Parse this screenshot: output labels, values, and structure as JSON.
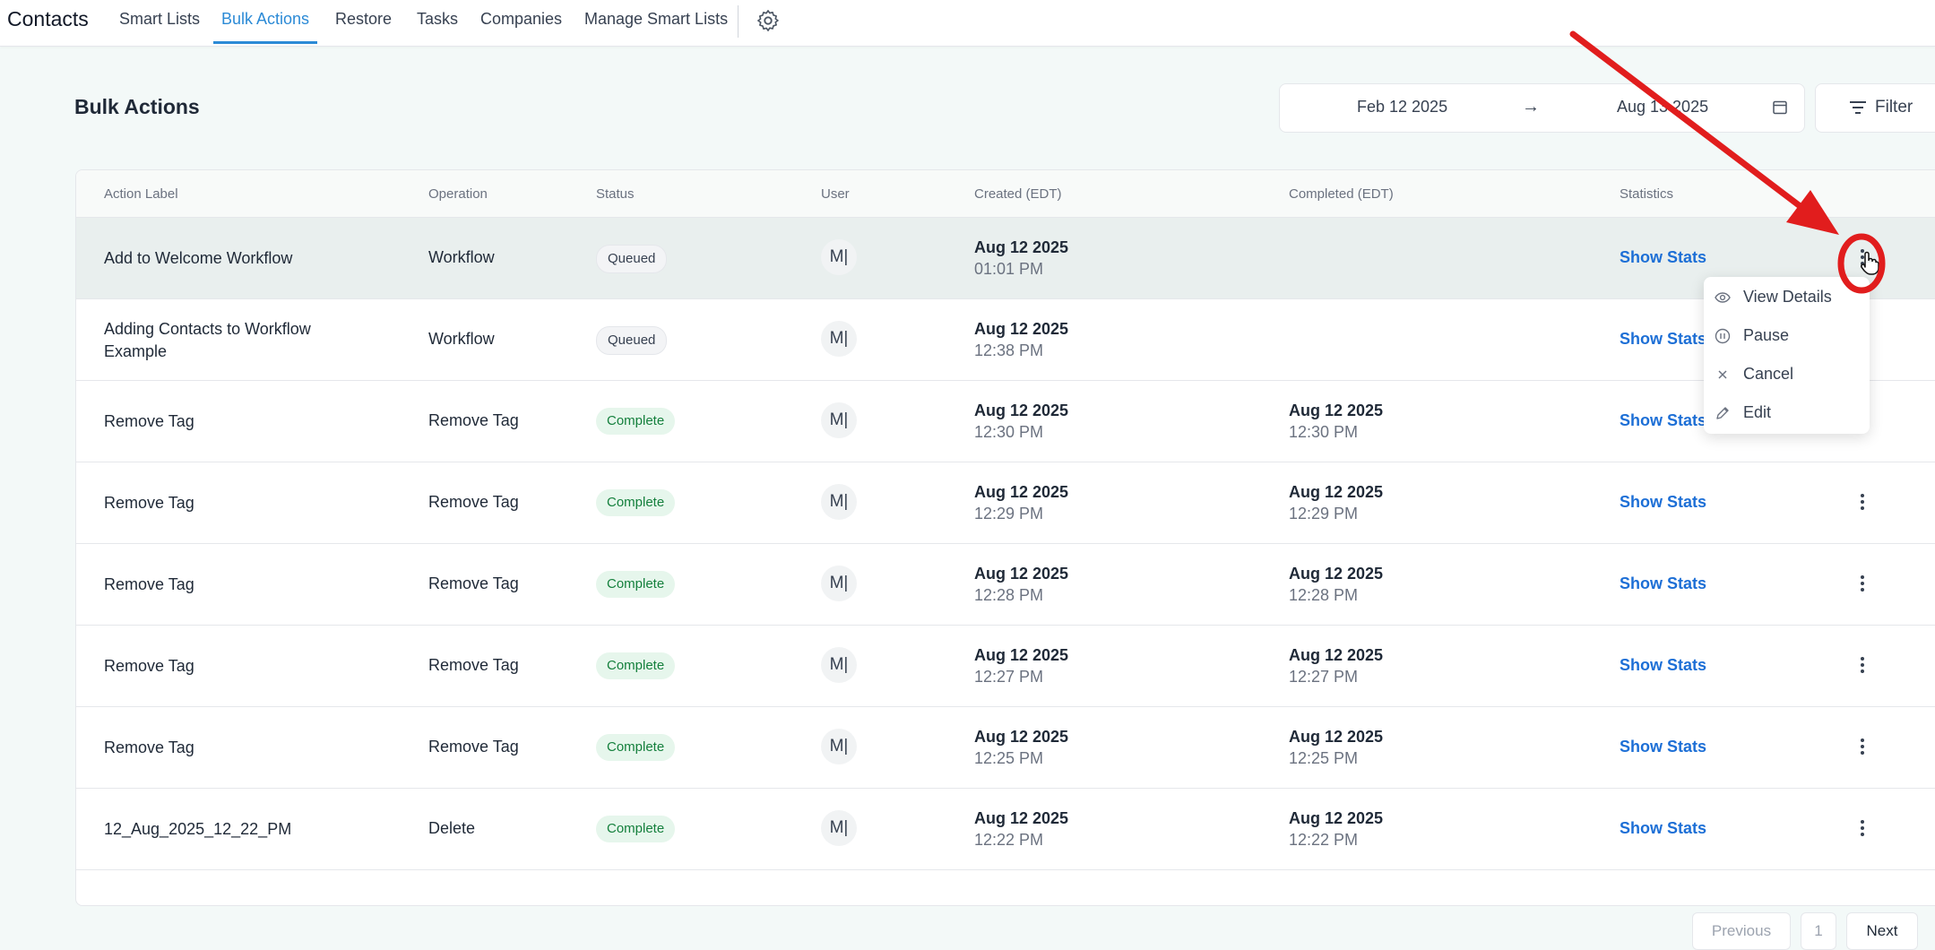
{
  "nav": {
    "brand": "Contacts",
    "tabs": [
      {
        "label": "Smart Lists"
      },
      {
        "label": "Bulk Actions"
      },
      {
        "label": "Restore"
      },
      {
        "label": "Tasks"
      },
      {
        "label": "Companies"
      },
      {
        "label": "Manage Smart Lists"
      }
    ],
    "active_tab": "Bulk Actions",
    "settings_icon": "gear-icon"
  },
  "page": {
    "title": "Bulk Actions"
  },
  "date_range": {
    "start": "Feb 12 2025",
    "arrow": "→",
    "end": "Aug 13 2025",
    "icon": "calendar-icon"
  },
  "filter": {
    "label": "Filter",
    "icon": "filter-icon"
  },
  "table": {
    "columns": [
      "Action Label",
      "Operation",
      "Status",
      "User",
      "Created (EDT)",
      "Completed (EDT)",
      "Statistics"
    ],
    "rows": [
      {
        "label_1": "Add to Welcome Workflow",
        "label_2": "",
        "operation": "Workflow",
        "status": "Queued",
        "user": "M|",
        "created_date": "Aug 12 2025",
        "created_time": "01:01 PM",
        "completed_date": "",
        "completed_time": "",
        "stats": "Show Stats"
      },
      {
        "label_1": "Adding Contacts to Workflow",
        "label_2": "Example",
        "operation": "Workflow",
        "status": "Queued",
        "user": "M|",
        "created_date": "Aug 12 2025",
        "created_time": "12:38 PM",
        "completed_date": "",
        "completed_time": "",
        "stats": "Show Stats"
      },
      {
        "label_1": "Remove Tag",
        "label_2": "",
        "operation": "Remove Tag",
        "status": "Complete",
        "user": "M|",
        "created_date": "Aug 12 2025",
        "created_time": "12:30 PM",
        "completed_date": "Aug 12 2025",
        "completed_time": "12:30 PM",
        "stats": "Show Stats"
      },
      {
        "label_1": "Remove Tag",
        "label_2": "",
        "operation": "Remove Tag",
        "status": "Complete",
        "user": "M|",
        "created_date": "Aug 12 2025",
        "created_time": "12:29 PM",
        "completed_date": "Aug 12 2025",
        "completed_time": "12:29 PM",
        "stats": "Show Stats"
      },
      {
        "label_1": "Remove Tag",
        "label_2": "",
        "operation": "Remove Tag",
        "status": "Complete",
        "user": "M|",
        "created_date": "Aug 12 2025",
        "created_time": "12:28 PM",
        "completed_date": "Aug 12 2025",
        "completed_time": "12:28 PM",
        "stats": "Show Stats"
      },
      {
        "label_1": "Remove Tag",
        "label_2": "",
        "operation": "Remove Tag",
        "status": "Complete",
        "user": "M|",
        "created_date": "Aug 12 2025",
        "created_time": "12:27 PM",
        "completed_date": "Aug 12 2025",
        "completed_time": "12:27 PM",
        "stats": "Show Stats"
      },
      {
        "label_1": "Remove Tag",
        "label_2": "",
        "operation": "Remove Tag",
        "status": "Complete",
        "user": "M|",
        "created_date": "Aug 12 2025",
        "created_time": "12:25 PM",
        "completed_date": "Aug 12 2025",
        "completed_time": "12:25 PM",
        "stats": "Show Stats"
      },
      {
        "label_1": "12_Aug_2025_12_22_PM",
        "label_2": "",
        "operation": "Delete",
        "status": "Complete",
        "user": "M|",
        "created_date": "Aug 12 2025",
        "created_time": "12:22 PM",
        "completed_date": "Aug 12 2025",
        "completed_time": "12:22 PM",
        "stats": "Show Stats"
      }
    ]
  },
  "row_menu": {
    "items": [
      {
        "label": "View Details",
        "icon": "eye-icon"
      },
      {
        "label": "Pause",
        "icon": "pause-icon"
      },
      {
        "label": "Cancel",
        "icon": "close-icon"
      },
      {
        "label": "Edit",
        "icon": "pencil-icon"
      }
    ]
  },
  "pagination": {
    "previous": "Previous",
    "page": "1",
    "next": "Next"
  },
  "colors": {
    "accent": "#2b8ad6",
    "link": "#1d6fd6",
    "complete_bg": "#e6f6ec",
    "complete_text": "#15803d",
    "annotation": "#e11d1d"
  }
}
